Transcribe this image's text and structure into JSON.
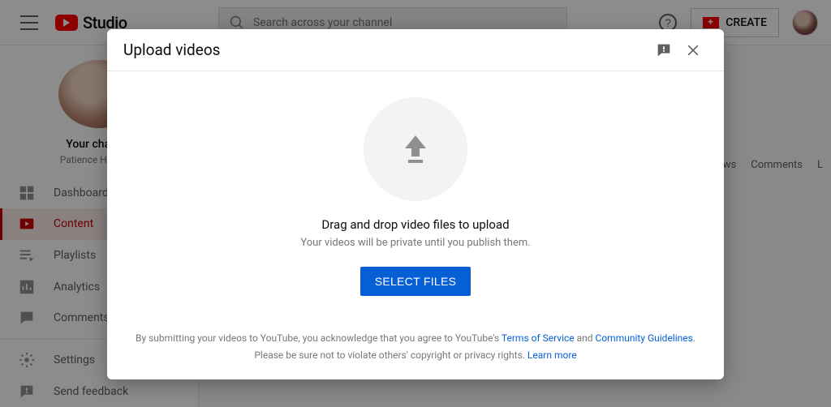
{
  "header": {
    "logo_text": "Studio",
    "search_placeholder": "Search across your channel",
    "create_label": "CREATE"
  },
  "sidebar": {
    "channel_title": "Your channel",
    "channel_subtitle": "Patience Hurlburt-",
    "items": [
      {
        "label": "Dashboard",
        "icon": "dashboard-icon",
        "active": false
      },
      {
        "label": "Content",
        "icon": "content-icon",
        "active": true
      },
      {
        "label": "Playlists",
        "icon": "playlists-icon",
        "active": false
      },
      {
        "label": "Analytics",
        "icon": "analytics-icon",
        "active": false
      },
      {
        "label": "Comments",
        "icon": "comments-icon",
        "active": false
      }
    ],
    "footer_items": [
      {
        "label": "Settings",
        "icon": "gear-icon"
      },
      {
        "label": "Send feedback",
        "icon": "feedback-icon"
      }
    ]
  },
  "content": {
    "columns": [
      "Views",
      "Comments",
      "L"
    ]
  },
  "modal": {
    "title": "Upload videos",
    "drop_title": "Drag and drop video files to upload",
    "drop_subtitle": "Your videos will be private until you publish them.",
    "select_button": "SELECT FILES",
    "footer_1a": "By submitting your videos to YouTube, you acknowledge that you agree to YouTube's ",
    "tos": "Terms of Service",
    "and": " and ",
    "guidelines": "Community Guidelines",
    "period": ".",
    "footer_2a": "Please be sure not to violate others' copyright or privacy rights. ",
    "learn_more": "Learn more"
  }
}
